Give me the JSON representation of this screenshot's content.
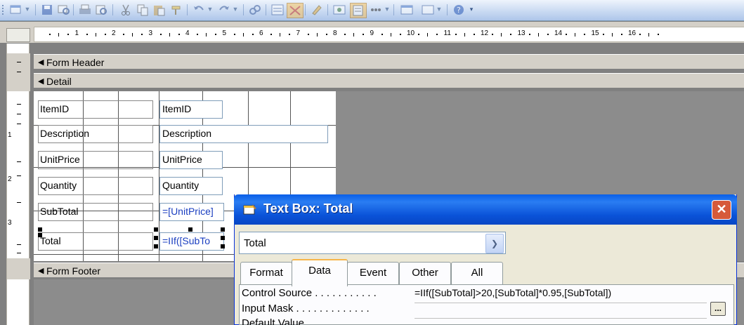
{
  "ruler": {
    "numbers": [
      "1",
      "2",
      "3",
      "4",
      "5",
      "6",
      "7",
      "8",
      "9",
      "10",
      "11",
      "12",
      "13",
      "14",
      "15",
      "16"
    ],
    "vnumbers": [
      "1",
      "2",
      "3"
    ]
  },
  "sections": {
    "form_header": "Form Header",
    "detail": "Detail",
    "form_footer": "Form Footer"
  },
  "fields": [
    {
      "label": "ItemID",
      "control": "ItemID"
    },
    {
      "label": "Description",
      "control": "Description"
    },
    {
      "label": "UnitPrice",
      "control": "UnitPrice"
    },
    {
      "label": "Quantity",
      "control": "Quantity"
    },
    {
      "label": "SubTotal",
      "control": "=[UnitPrice]"
    },
    {
      "label": "Total",
      "control": "=IIf([SubTo"
    }
  ],
  "dialog": {
    "title": "Text Box: Total",
    "close_label": "✕",
    "object_name": "Total",
    "tabs": [
      "Format",
      "Data",
      "Event",
      "Other",
      "All"
    ],
    "active_tab": "Data",
    "properties": [
      {
        "name": "Control Source . . . . . . . . . . .",
        "value": "=IIf([SubTotal]>20,[SubTotal]*0.95,[SubTotal])"
      },
      {
        "name": "Input Mask . . . . . . . . . . . . .",
        "value": ""
      },
      {
        "name": "Default Value",
        "value": ""
      }
    ],
    "build_label": "..."
  },
  "colors": {
    "title_bar": "#0a52d8",
    "detail_bg": "#ffffff",
    "workspace": "#8c8c8c"
  }
}
